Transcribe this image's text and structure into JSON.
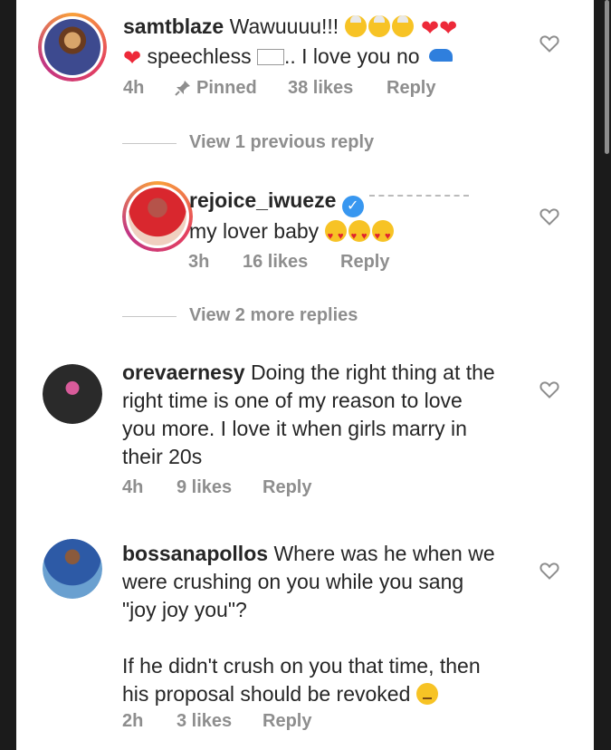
{
  "comments": [
    {
      "username": "samtblaze",
      "text_line1": "Wawuuuu!!!",
      "text_line2": "speechless ",
      "text_line2b": ".. I love you no",
      "time": "4h",
      "pinned_label": "Pinned",
      "likes": "38 likes",
      "reply_label": "Reply",
      "view_replies": "View 1 previous reply"
    },
    {
      "username": "rejoice_iwueze",
      "text": "my lover baby",
      "time": "3h",
      "likes": "16 likes",
      "reply_label": "Reply",
      "view_replies": "View 2 more replies"
    },
    {
      "username": "orevaernesy",
      "lines": [
        "Doing the right thing at the",
        "right time is one of my reason to love",
        "you more. I love it when girls marry in",
        "their 20s"
      ],
      "time": "4h",
      "likes": "9 likes",
      "reply_label": "Reply"
    },
    {
      "username": "bossanapollos",
      "lines": [
        "Where was he when we",
        "were crushing on you while you sang",
        "\"joy joy you\"?",
        "",
        "If he didn't crush on you that time, then",
        "his proposal should be revoked"
      ],
      "time": "2h",
      "likes": "3 likes",
      "reply_label": "Reply"
    }
  ],
  "colors": {
    "text": "#262626",
    "meta": "#8e8e8e",
    "verified": "#3897f0",
    "heart": "#ed2939"
  },
  "icons": {
    "like": "heart-outline-icon",
    "pin": "pin-icon",
    "verified": "verified-badge-icon"
  }
}
